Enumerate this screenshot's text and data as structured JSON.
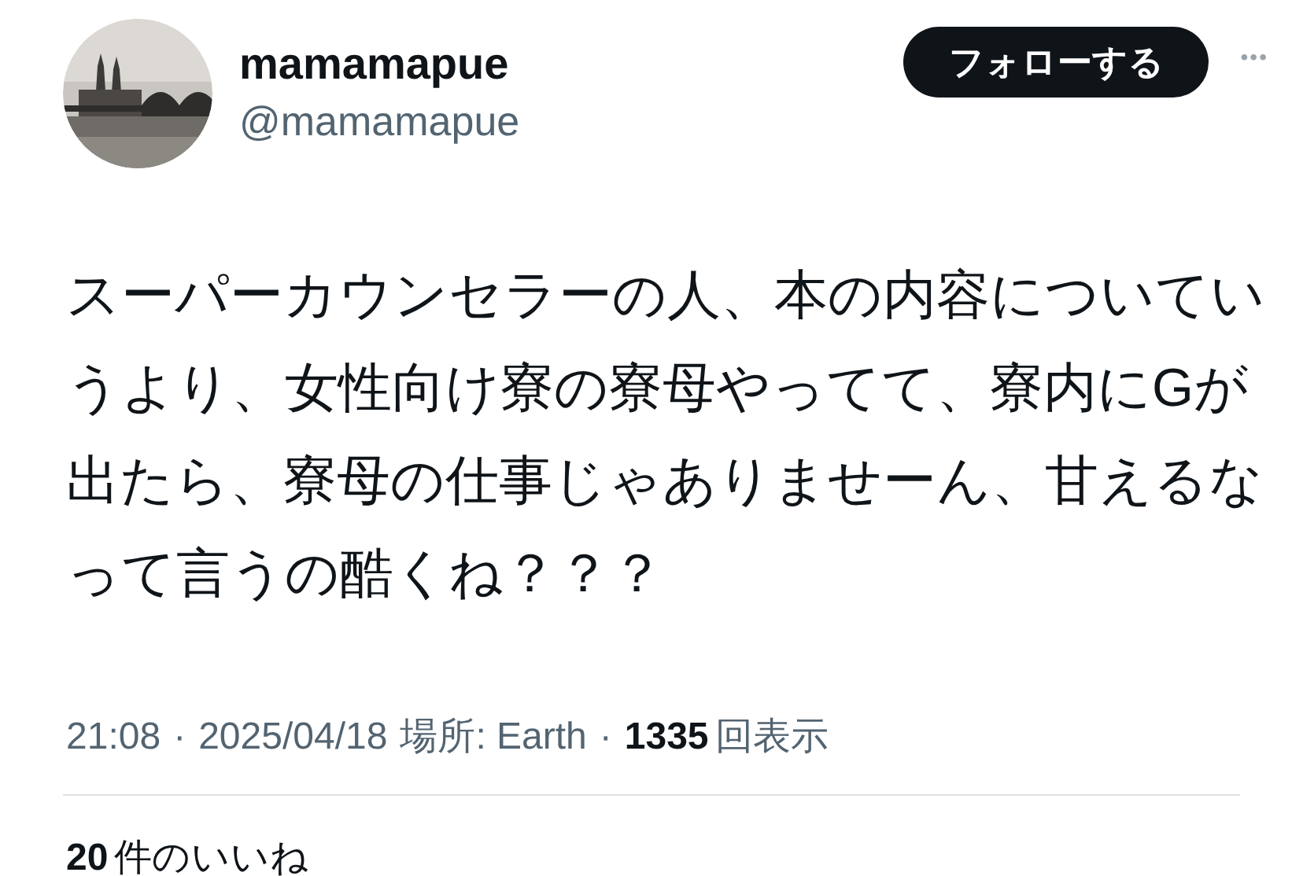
{
  "author": {
    "name": "mamamapue",
    "handle": "@mamamapue"
  },
  "follow_button": {
    "label": "フォローする"
  },
  "more_button": {
    "label": "•••"
  },
  "tweet": {
    "text": "スーパーカウンセラーの人、本の内容についていうより、女性向け寮の寮母やってて、寮内にGが出たら、寮母の仕事じゃありませーん、甘えるなって言うの酷くね？？？"
  },
  "meta": {
    "time": "21:08",
    "separator": "·",
    "date": "2025/04/18",
    "location": "場所: Earth",
    "separator_2": "·",
    "views_count": "1335",
    "views_label": "回表示"
  },
  "likes": {
    "count": "20",
    "label": "件のいいね"
  }
}
